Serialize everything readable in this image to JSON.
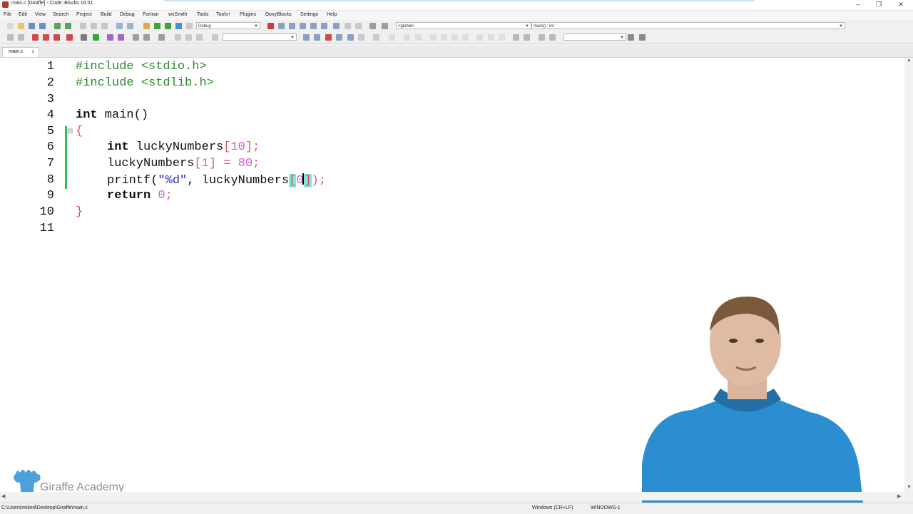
{
  "window": {
    "title": "main.c [Giraffe] - Code::Blocks 16.01"
  },
  "menu": [
    "File",
    "Edit",
    "View",
    "Search",
    "Project",
    "Build",
    "Debug",
    "Fortran",
    "wxSmith",
    "Tools",
    "Tools+",
    "Plugins",
    "DoxyBlocks",
    "Settings",
    "Help"
  ],
  "toolbar": {
    "build_target": "Debug",
    "scope": "<global>",
    "function": "main() : int"
  },
  "tabs": [
    {
      "label": "main.c"
    }
  ],
  "editor": {
    "line_numbers": [
      "1",
      "2",
      "3",
      "4",
      "5",
      "6",
      "7",
      "8",
      "9",
      "10",
      "11"
    ],
    "lines": {
      "l1": {
        "directive": "#include",
        "header": " <stdio.h>"
      },
      "l2": {
        "directive": "#include",
        "header": " <stdlib.h>"
      },
      "l4": {
        "kw": "int",
        "rest": " main()"
      },
      "l5": {
        "brace": "{"
      },
      "l6": {
        "kw": "int",
        "name": " luckyNumbers",
        "open": "[",
        "num": "10",
        "close": "];"
      },
      "l7": {
        "name": "luckyNumbers",
        "open": "[",
        "num": "1",
        "close": "]",
        "op": " = ",
        "val": "80",
        "end": ";"
      },
      "l8": {
        "fn": "printf(",
        "str": "\"%d\"",
        "mid": ", luckyNumbers",
        "open": "[",
        "num": "0",
        "close": "]",
        "end": ");"
      },
      "l9": {
        "kw": "return",
        "num": " 0",
        "end": ";"
      },
      "l10": {
        "brace": "}"
      }
    }
  },
  "statusbar": {
    "path": "C:\\Users\\miked\\Desktop\\Giraffe\\main.c",
    "eol": "Windows (CR+LF)",
    "encoding": "WINDOWS-1"
  },
  "watermark": {
    "text": "Giraffe Academy"
  },
  "colors": {
    "change_bar": "#2fbf56",
    "brace_match": "#7fe8e0",
    "number": "#d35fd9",
    "preprocessor": "#2e8b2e"
  }
}
